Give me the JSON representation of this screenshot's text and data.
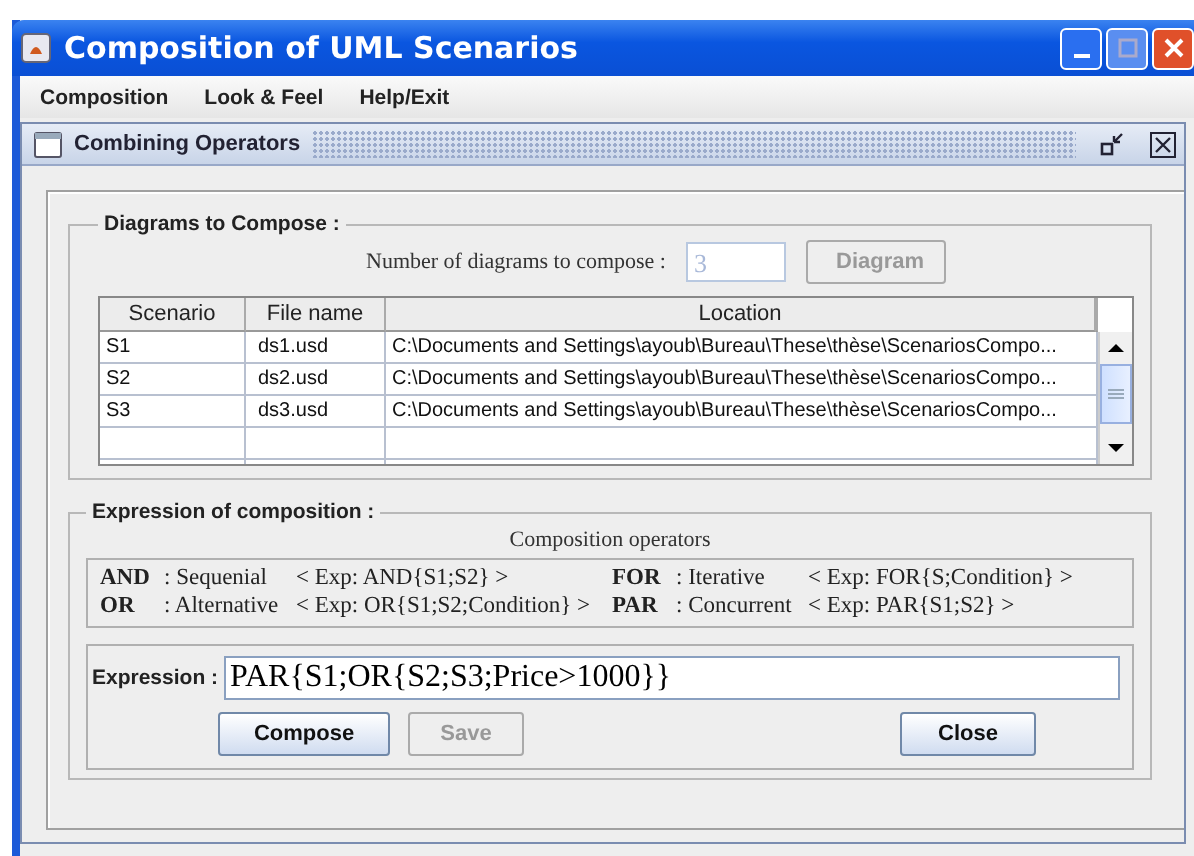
{
  "window": {
    "title": "Composition of UML Scenarios"
  },
  "menu": [
    "Composition",
    "Look & Feel",
    "Help/Exit"
  ],
  "frame": {
    "title": "Combining Operators"
  },
  "diagrams": {
    "legend": "Diagrams to Compose :",
    "count_label": "Number of diagrams to compose :",
    "count_value": "3",
    "count_disabled": true,
    "diagram_button": {
      "label": "Diagram",
      "disabled": true
    },
    "columns": [
      "Scenario",
      "File name",
      "Location"
    ],
    "rows": [
      {
        "cells": [
          "S1",
          "ds1.usd",
          "C:\\Documents and Settings\\ayoub\\Bureau\\These\\thèse\\ScenariosCompo..."
        ]
      },
      {
        "cells": [
          "S2",
          "ds2.usd",
          "C:\\Documents and Settings\\ayoub\\Bureau\\These\\thèse\\ScenariosCompo..."
        ]
      },
      {
        "cells": [
          "S3",
          "ds3.usd",
          "C:\\Documents and Settings\\ayoub\\Bureau\\These\\thèse\\ScenariosCompo..."
        ]
      }
    ]
  },
  "expression_section": {
    "legend": "Expression of composition :",
    "operators_title": "Composition operators",
    "operators": [
      {
        "keyword": "AND",
        "meaning": ": Sequenial",
        "example": "< Exp: AND{S1;S2} >"
      },
      {
        "keyword": "FOR",
        "meaning": ": Iterative",
        "example": "< Exp: FOR{S;Condition} >"
      },
      {
        "keyword": "OR",
        "meaning": ": Alternative",
        "example": "< Exp: OR{S1;S2;Condition} >"
      },
      {
        "keyword": "PAR",
        "meaning": ": Concurrent",
        "example": "< Exp: PAR{S1;S2} >"
      }
    ],
    "expression_label": "Expression :",
    "expression_value": "PAR{S1;OR{S2;S3;Price>1000}}",
    "buttons": [
      {
        "label": "Compose",
        "disabled": false
      },
      {
        "label": "Save",
        "disabled": true
      },
      {
        "label": "Close",
        "disabled": false
      }
    ]
  }
}
